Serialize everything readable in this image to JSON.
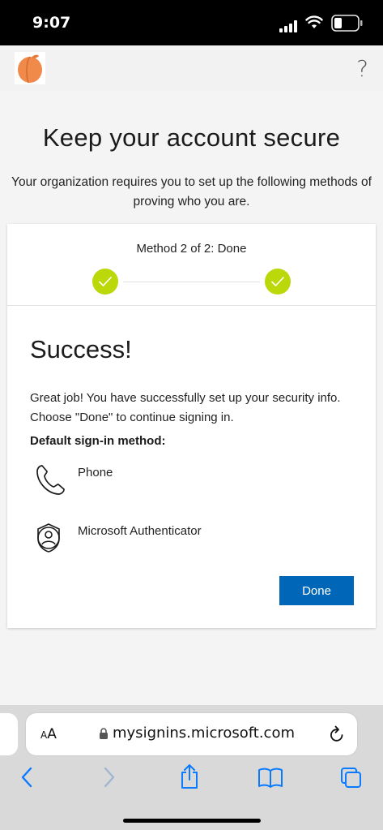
{
  "status_bar": {
    "time": "9:07"
  },
  "header": {
    "help_label": "?"
  },
  "page": {
    "title": "Keep your account secure",
    "subtitle": "Your organization requires you to set up the following methods of proving who you are."
  },
  "progress": {
    "label": "Method 2 of 2: Done",
    "steps_completed": 2,
    "steps_total": 2
  },
  "success": {
    "title": "Success!",
    "message": "Great job! You have successfully set up your security info. Choose \"Done\" to continue signing in.",
    "default_label": "Default sign-in method:",
    "methods": [
      {
        "label": "Phone",
        "icon": "phone-icon"
      },
      {
        "label": "Microsoft Authenticator",
        "icon": "authenticator-icon"
      }
    ],
    "done_label": "Done"
  },
  "browser": {
    "text_size_label_big": "A",
    "text_size_label_small": "A",
    "url": "mysignins.microsoft.com"
  },
  "colors": {
    "accent": "#0067b8",
    "step_complete": "#bad80a",
    "logo": "#f08a4b"
  }
}
